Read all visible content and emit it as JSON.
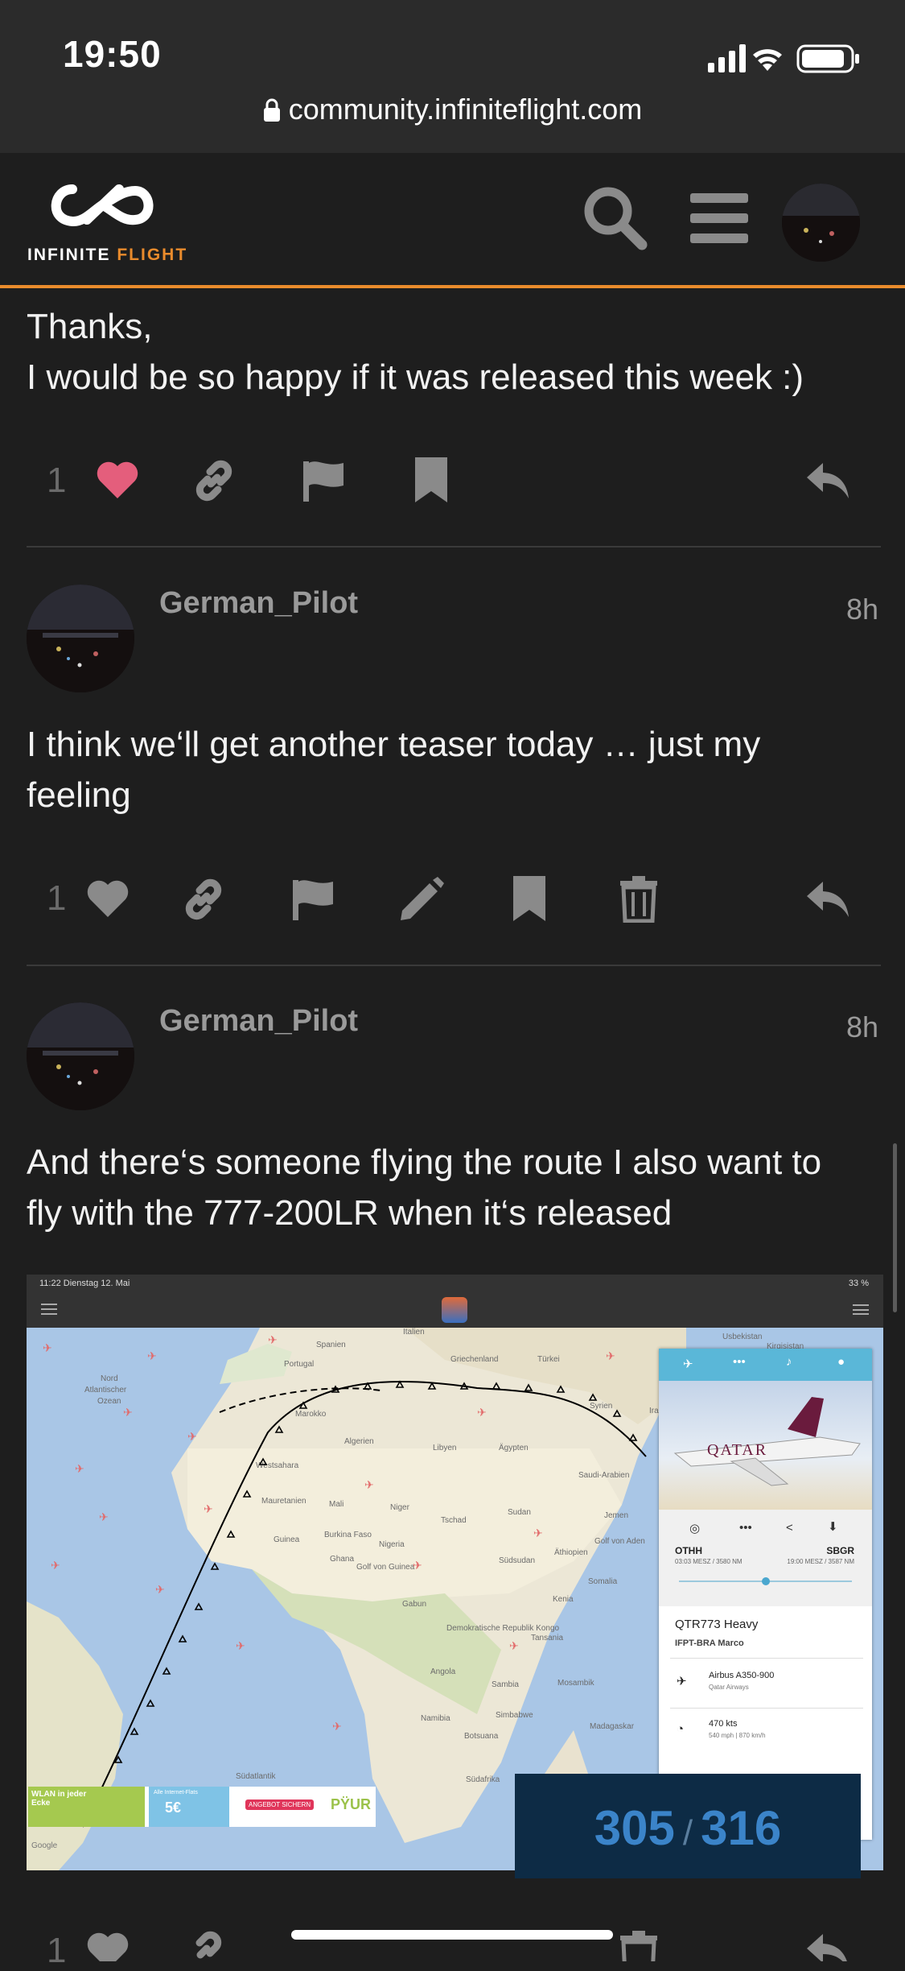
{
  "status_bar": {
    "time": "19:50",
    "url": "community.infiniteflight.com"
  },
  "header": {
    "logo_text_white": "INFINITE",
    "logo_text_orange": "FLIGHT"
  },
  "colors": {
    "accent": "#e98b2c",
    "like": "#e45e7c",
    "background": "#1e1e1e",
    "counter_blue": "#3b84c9"
  },
  "posts": [
    {
      "lines": [
        "Thanks,",
        "I would be so happy if it was released this week :)"
      ],
      "like_count": "1",
      "actions": [
        "heart-icon",
        "link-icon",
        "flag-icon",
        "bookmark-icon",
        "reply-icon"
      ]
    },
    {
      "username": "German_Pilot",
      "time": "8h",
      "lines": [
        "I think we‘ll get another teaser today … just my",
        "feeling"
      ],
      "like_count": "1",
      "actions": [
        "heart-icon",
        "link-icon",
        "flag-icon",
        "pencil-icon",
        "bookmark-icon",
        "trash-icon",
        "reply-icon"
      ]
    },
    {
      "username": "German_Pilot",
      "time": "8h",
      "lines": [
        "And there‘s someone flying the route I also want to",
        "fly with the 777-200LR when it‘s released"
      ],
      "like_count": "1"
    }
  ],
  "embedded_screenshot": {
    "status_time": "11:22  Dienstag 12. Mai",
    "battery": "33 %",
    "map_labels": [
      "Usbekistan",
      "Kirgisistan",
      "Italien",
      "Spanien",
      "Portugal",
      "Griechenland",
      "Türkei",
      "Nord",
      "Atlantischer",
      "Ozean",
      "Marokko",
      "Algerien",
      "Libyen",
      "Ägypten",
      "Syrien",
      "Iran",
      "Saudi-Arabien",
      "Westsahara",
      "Mauretanien",
      "Mali",
      "Niger",
      "Tschad",
      "Sudan",
      "Jemen",
      "Burkina Faso",
      "Guinea",
      "Ghana",
      "Nigeria",
      "Golf von Aden",
      "Äthiopien",
      "Südsudan",
      "Somalia",
      "Kenia",
      "Gabun",
      "Demokratische Republik Kongo",
      "Tansania",
      "Angola",
      "Sambia",
      "Mosambik",
      "Namibia",
      "Simbabwe",
      "Botsuana",
      "Madagaskar",
      "Südafrika",
      "Südatlantik",
      "Golf von Guinea",
      "Google"
    ],
    "flight_card": {
      "from": "OTHH",
      "from_time": "03:03 MESZ / 3580 NM",
      "to": "SBGR",
      "to_time": "19:00 MESZ / 3587 NM",
      "callsign": "QTR773 Heavy",
      "user": "IFPT-BRA Marco",
      "aircraft": "Airbus A350-900",
      "airline": "Qatar Airways",
      "speed": "470 kts",
      "speed_sub": "540 mph | 870 km/h",
      "livery_text": "QATAR"
    },
    "ad": {
      "title": "WLAN in jeder Ecke",
      "price_label": "Alle Internet-Flats",
      "price": "5€",
      "cta": "ANGEBOT SICHERN",
      "brand": "PŸUR"
    }
  },
  "post_counter": {
    "current": "305",
    "total": "316"
  }
}
